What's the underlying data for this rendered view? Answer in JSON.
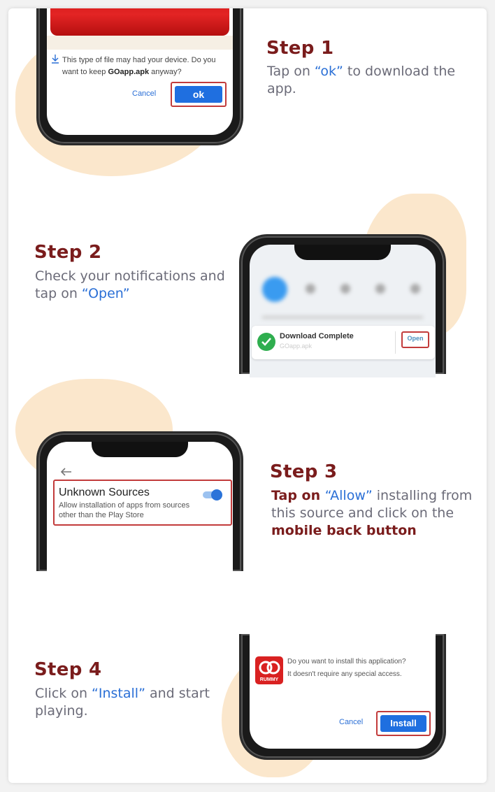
{
  "step1": {
    "title": "Step 1",
    "text_pre": "Tap on ",
    "text_hl": "“ok”",
    "text_post": " to download the app.",
    "dialog_line1": "This type of file may had your device. Do you",
    "dialog_line2_pre": "want to keep ",
    "dialog_filename": "GOapp.apk",
    "dialog_line2_post": " anyway?",
    "cancel_label": "Cancel",
    "ok_label": "ok"
  },
  "step2": {
    "title": "Step 2",
    "text_pre": "Check your notifications and tap on ",
    "text_hl": "“Open”",
    "notif_title": "Download Complete",
    "notif_sub": "GOapp.apk",
    "open_label": "Open"
  },
  "step3": {
    "title": "Step 3",
    "text_a": "Tap on ",
    "text_hl": "“Allow”",
    "text_b": " installing from this source and click on the ",
    "text_c": "mobile back button",
    "setting_title": "Unknown Sources",
    "setting_desc": "Allow installation of apps from sources other than the Play Store"
  },
  "step4": {
    "title": "Step 4",
    "text_pre": "Click on ",
    "text_hl": "“Install”",
    "text_post": " and start playing.",
    "install_q1": "Do you want to install this application?",
    "install_q2": "It doesn't require any special access.",
    "app_badge": "RUMMY",
    "cancel_label": "Cancel",
    "install_label": "Install"
  },
  "colors": {
    "accent_blue": "#1f6fe0",
    "title_red": "#7a1c1c",
    "highlight_box": "#c23b3b",
    "blob": "#fbe7cc",
    "toggle_blue": "#2a73d9",
    "check_green": "#2fae4f"
  },
  "icons": {
    "download": "download-icon",
    "check": "check-circle-icon",
    "back": "back-arrow-icon",
    "toggle": "toggle-on-icon"
  }
}
